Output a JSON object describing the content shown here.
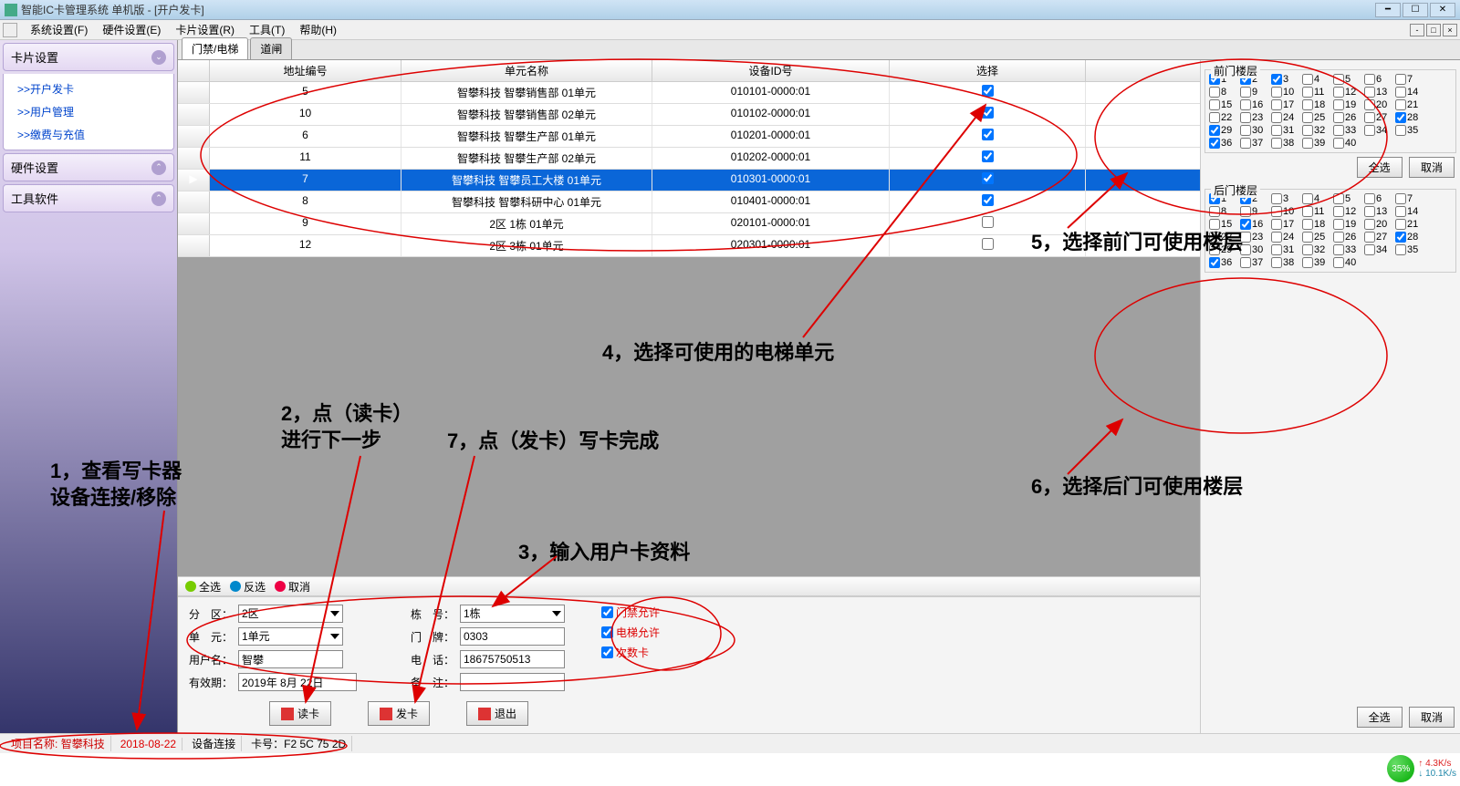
{
  "window": {
    "title": "智能IC卡管理系统 单机版 - [开户发卡]"
  },
  "menu": {
    "system": "系统设置(F)",
    "hardware": "硬件设置(E)",
    "card": "卡片设置(R)",
    "tool": "工具(T)",
    "help": "帮助(H)"
  },
  "sidebar": {
    "card_settings": "卡片设置",
    "links": {
      "open": ">>开户发卡",
      "user": ">>用户管理",
      "fee": ">>缴费与充值"
    },
    "hardware_settings": "硬件设置",
    "tool_software": "工具软件"
  },
  "tabs": {
    "elevator": "门禁/电梯",
    "gate": "道闸"
  },
  "grid": {
    "headers": {
      "addr": "地址编号",
      "unit": "单元名称",
      "dev": "设备ID号",
      "sel": "选择"
    },
    "rows": [
      {
        "addr": "5",
        "unit": "智攀科技 智攀销售部 01单元",
        "dev": "010101-0000:01",
        "checked": true
      },
      {
        "addr": "10",
        "unit": "智攀科技 智攀销售部 02单元",
        "dev": "010102-0000:01",
        "checked": true
      },
      {
        "addr": "6",
        "unit": "智攀科技 智攀生产部 01单元",
        "dev": "010201-0000:01",
        "checked": true
      },
      {
        "addr": "11",
        "unit": "智攀科技 智攀生产部 02单元",
        "dev": "010202-0000:01",
        "checked": true
      },
      {
        "addr": "7",
        "unit": "智攀科技 智攀员工大楼 01单元",
        "dev": "010301-0000:01",
        "checked": true,
        "selected": true
      },
      {
        "addr": "8",
        "unit": "智攀科技 智攀科研中心 01单元",
        "dev": "010401-0000:01",
        "checked": true
      },
      {
        "addr": "9",
        "unit": "2区 1栋 01单元",
        "dev": "020101-0000:01",
        "checked": false
      },
      {
        "addr": "12",
        "unit": "2区 3栋 01单元",
        "dev": "020301-0000:01",
        "checked": false
      }
    ]
  },
  "floors": {
    "front_label": "前门楼层",
    "back_label": "后门楼层",
    "select_all": "全选",
    "cancel": "取消",
    "front_checked": [
      1,
      2,
      3,
      28,
      29,
      36
    ],
    "back_checked": [
      1,
      2,
      16,
      28,
      36
    ],
    "count": 40
  },
  "selbar": {
    "all": "全选",
    "invert": "反选",
    "cancel": "取消"
  },
  "form": {
    "zone_l": "分　区：",
    "zone_v": "2区",
    "building_l": "栋　号：",
    "building_v": "1栋",
    "unit_l": "单　元：",
    "unit_v": "1单元",
    "door_l": "门　牌：",
    "door_v": "0303",
    "user_l": "用户名：",
    "user_v": "智攀",
    "phone_l": "电　话：",
    "phone_v": "18675750513",
    "expire_l": "有效期：",
    "expire_v": "2019年 8月 22日",
    "remark_l": "备　注：",
    "remark_v": "",
    "perm_door": "门禁允许",
    "perm_elev": "电梯允许",
    "perm_count": "次数卡"
  },
  "buttons": {
    "read": "读卡",
    "write": "发卡",
    "exit": "退出"
  },
  "statusbar": {
    "proj_label": "项目名称:",
    "proj_value": "智攀科技",
    "date": "2018-08-22",
    "conn": "设备连接",
    "card_l": "卡号：",
    "card_v": "F2 5C 75 2D"
  },
  "net": {
    "pct": "35%",
    "up": "4.3K/s",
    "down": "10.1K/s"
  },
  "annot": {
    "a1a": "1，查看写卡器",
    "a1b": "设备连接/移除",
    "a2a": "2，点（读卡）",
    "a2b": "进行下一步",
    "a3": "3，输入用户卡资料",
    "a4": "4，选择可使用的电梯单元",
    "a5": "5，选择前门可使用楼层",
    "a6": "6，选择后门可使用楼层",
    "a7": "7，点（发卡）写卡完成"
  }
}
